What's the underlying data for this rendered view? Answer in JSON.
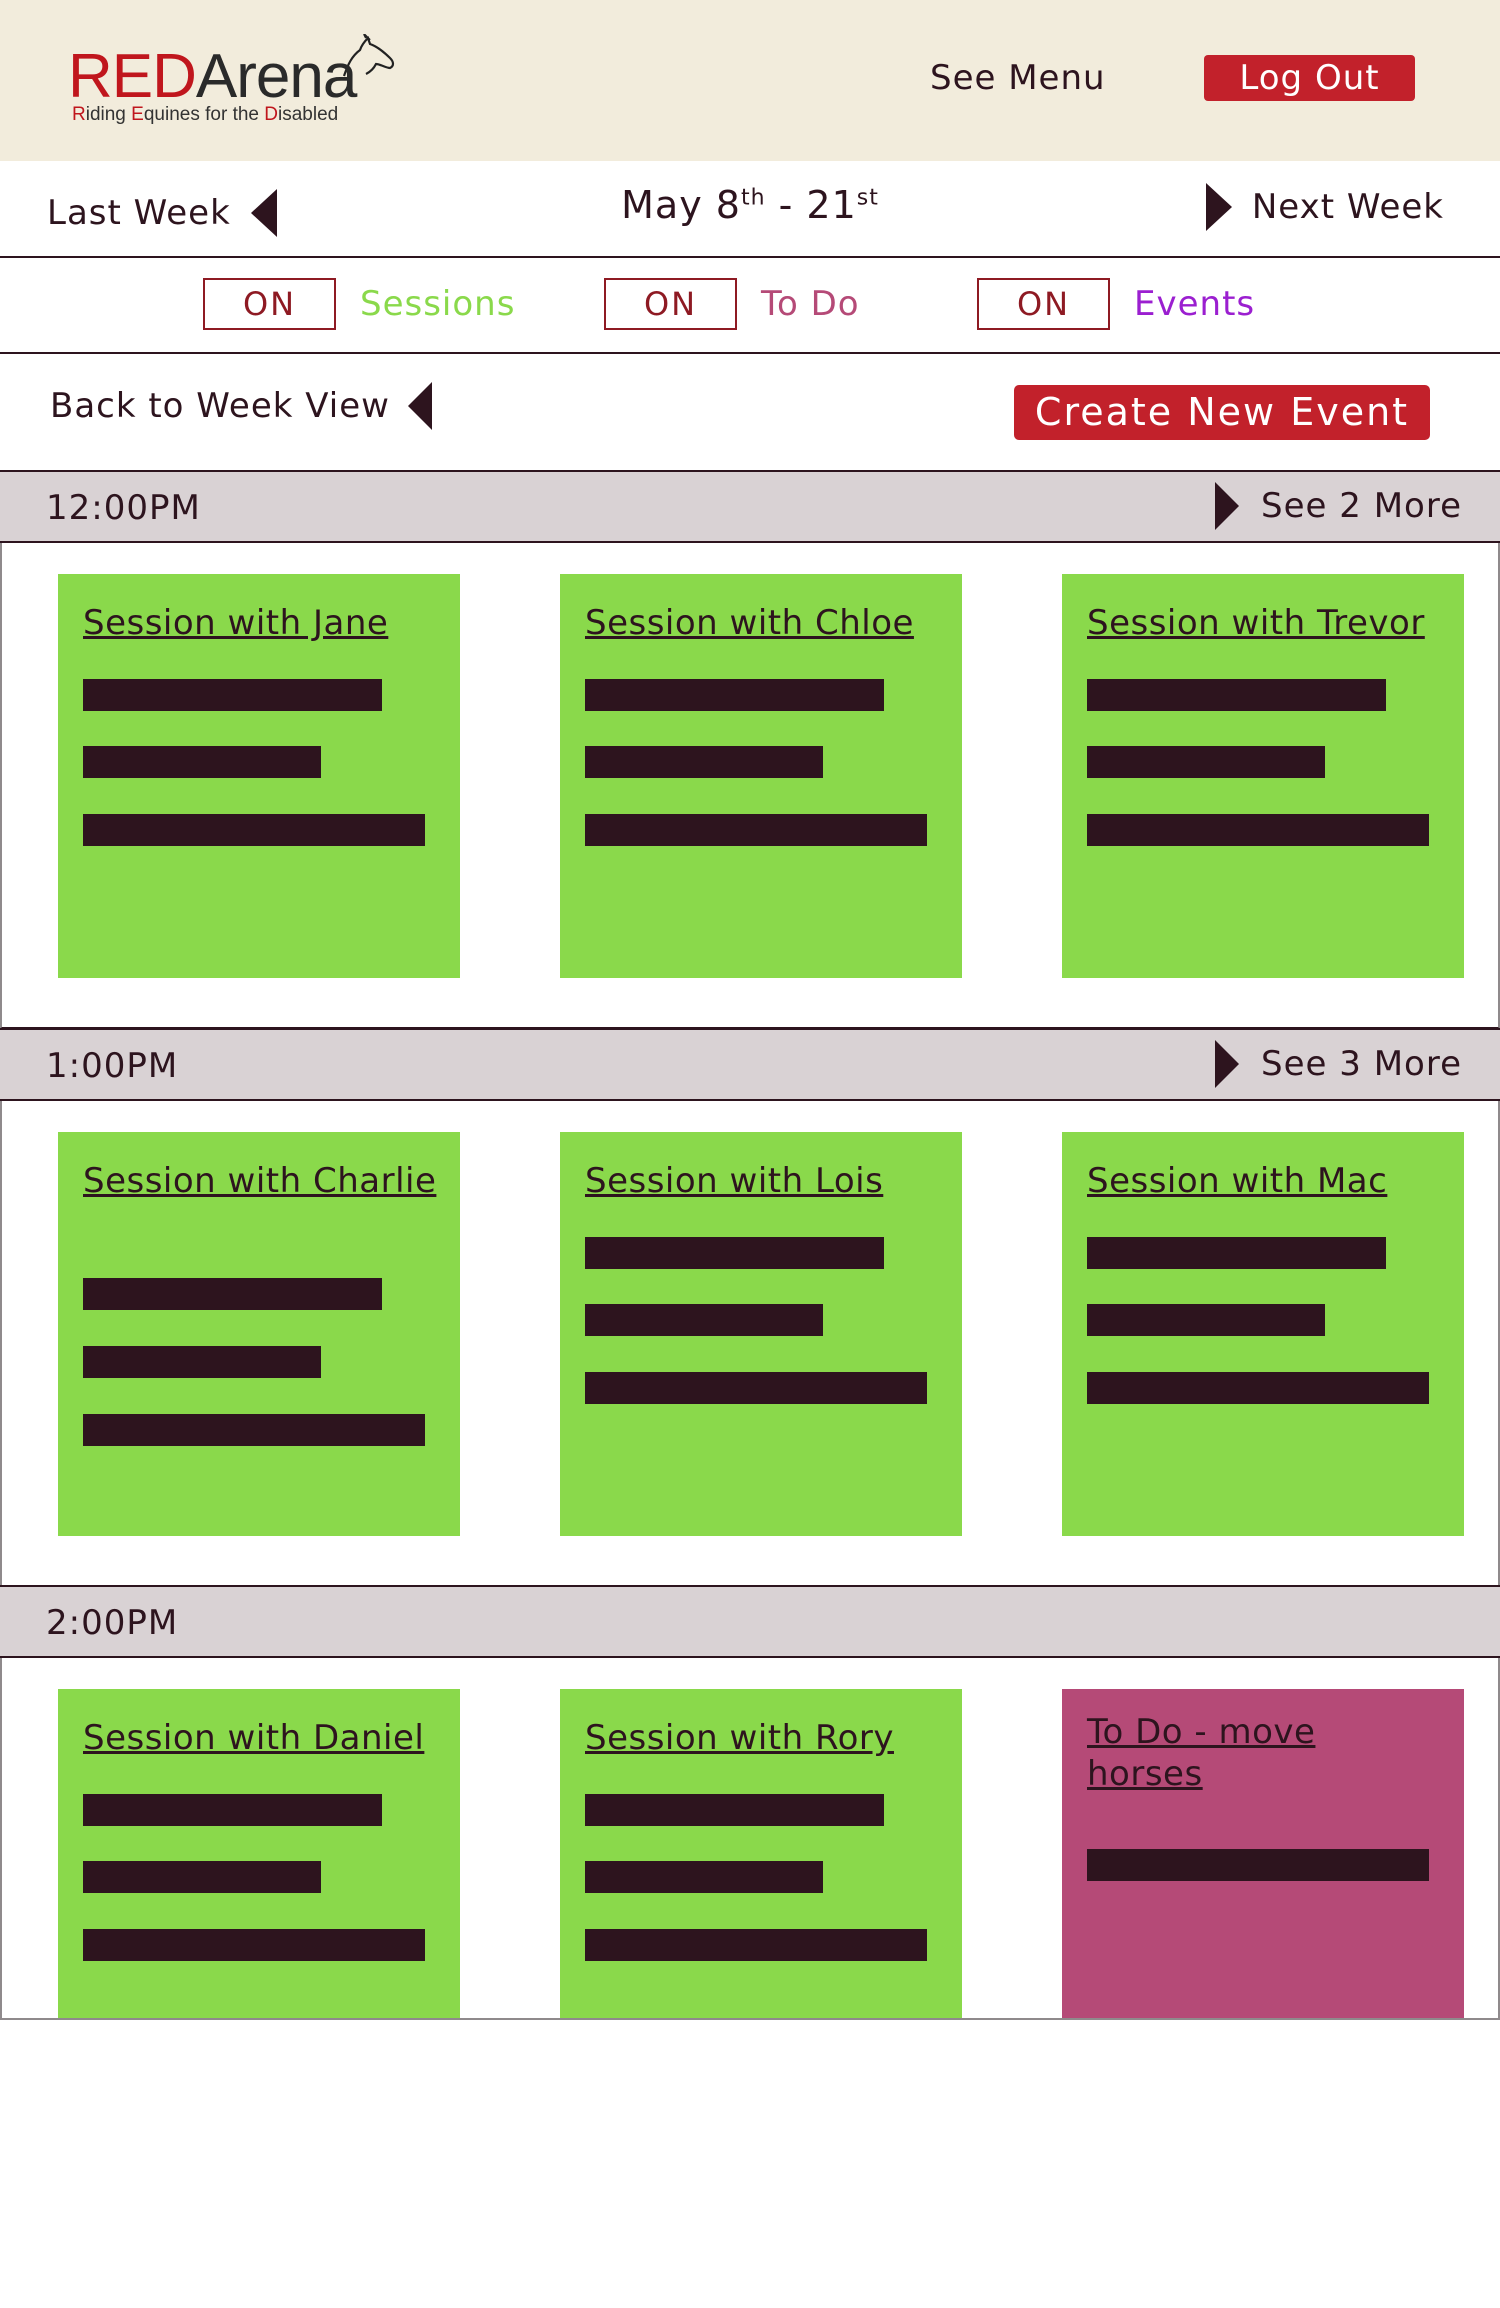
{
  "header": {
    "logo_red": "RED",
    "logo_dark": "Arena",
    "logo_sub_parts": [
      "R",
      "iding ",
      "E",
      "quines for the ",
      "D",
      "isabled"
    ],
    "see_menu": "See Menu",
    "logout": "Log Out"
  },
  "week_nav": {
    "last_week": "Last Week",
    "date_start": "May 8",
    "date_start_sup": "th",
    "date_sep": " - 21",
    "date_end_sup": "st",
    "next_week": "Next Week"
  },
  "filters": [
    {
      "toggle": "ON",
      "label": "Sessions",
      "color": "#8ad94b"
    },
    {
      "toggle": "ON",
      "label": "To Do",
      "color": "#b54a77"
    },
    {
      "toggle": "ON",
      "label": "Events",
      "color": "#9b1fd0"
    }
  ],
  "actions": {
    "back_to_week": "Back to Week View",
    "create_event": "Create New Event"
  },
  "slots": [
    {
      "time": "12:00PM",
      "see_more": "See 2 More",
      "cards": [
        {
          "title": "Session with Jane",
          "type": "session",
          "bars": 3
        },
        {
          "title": "Session with Chloe",
          "type": "session",
          "bars": 3
        },
        {
          "title": "Session with Trevor",
          "type": "session",
          "bars": 3
        }
      ]
    },
    {
      "time": "1:00PM",
      "see_more": "See 3 More",
      "cards": [
        {
          "title": "Session with Charlie",
          "type": "session",
          "bars": 3
        },
        {
          "title": "Session with Lois",
          "type": "session",
          "bars": 3
        },
        {
          "title": "Session with Mac",
          "type": "session",
          "bars": 3
        }
      ]
    },
    {
      "time": "2:00PM",
      "see_more": "",
      "cards": [
        {
          "title": "Session with Daniel",
          "type": "session",
          "bars": 3
        },
        {
          "title": "Session with Rory",
          "type": "session",
          "bars": 3
        },
        {
          "title": "To Do - move horses",
          "type": "todo",
          "bars": 1
        }
      ]
    }
  ],
  "colors": {
    "brand_red": "#c2212b",
    "header_bg": "#f2ecdc",
    "session_green": "#8ad94b",
    "todo_pink": "#b54a77",
    "events_purple": "#9b1fd0",
    "slot_header_bg": "#d9d2d4",
    "ink": "#2d141e"
  }
}
